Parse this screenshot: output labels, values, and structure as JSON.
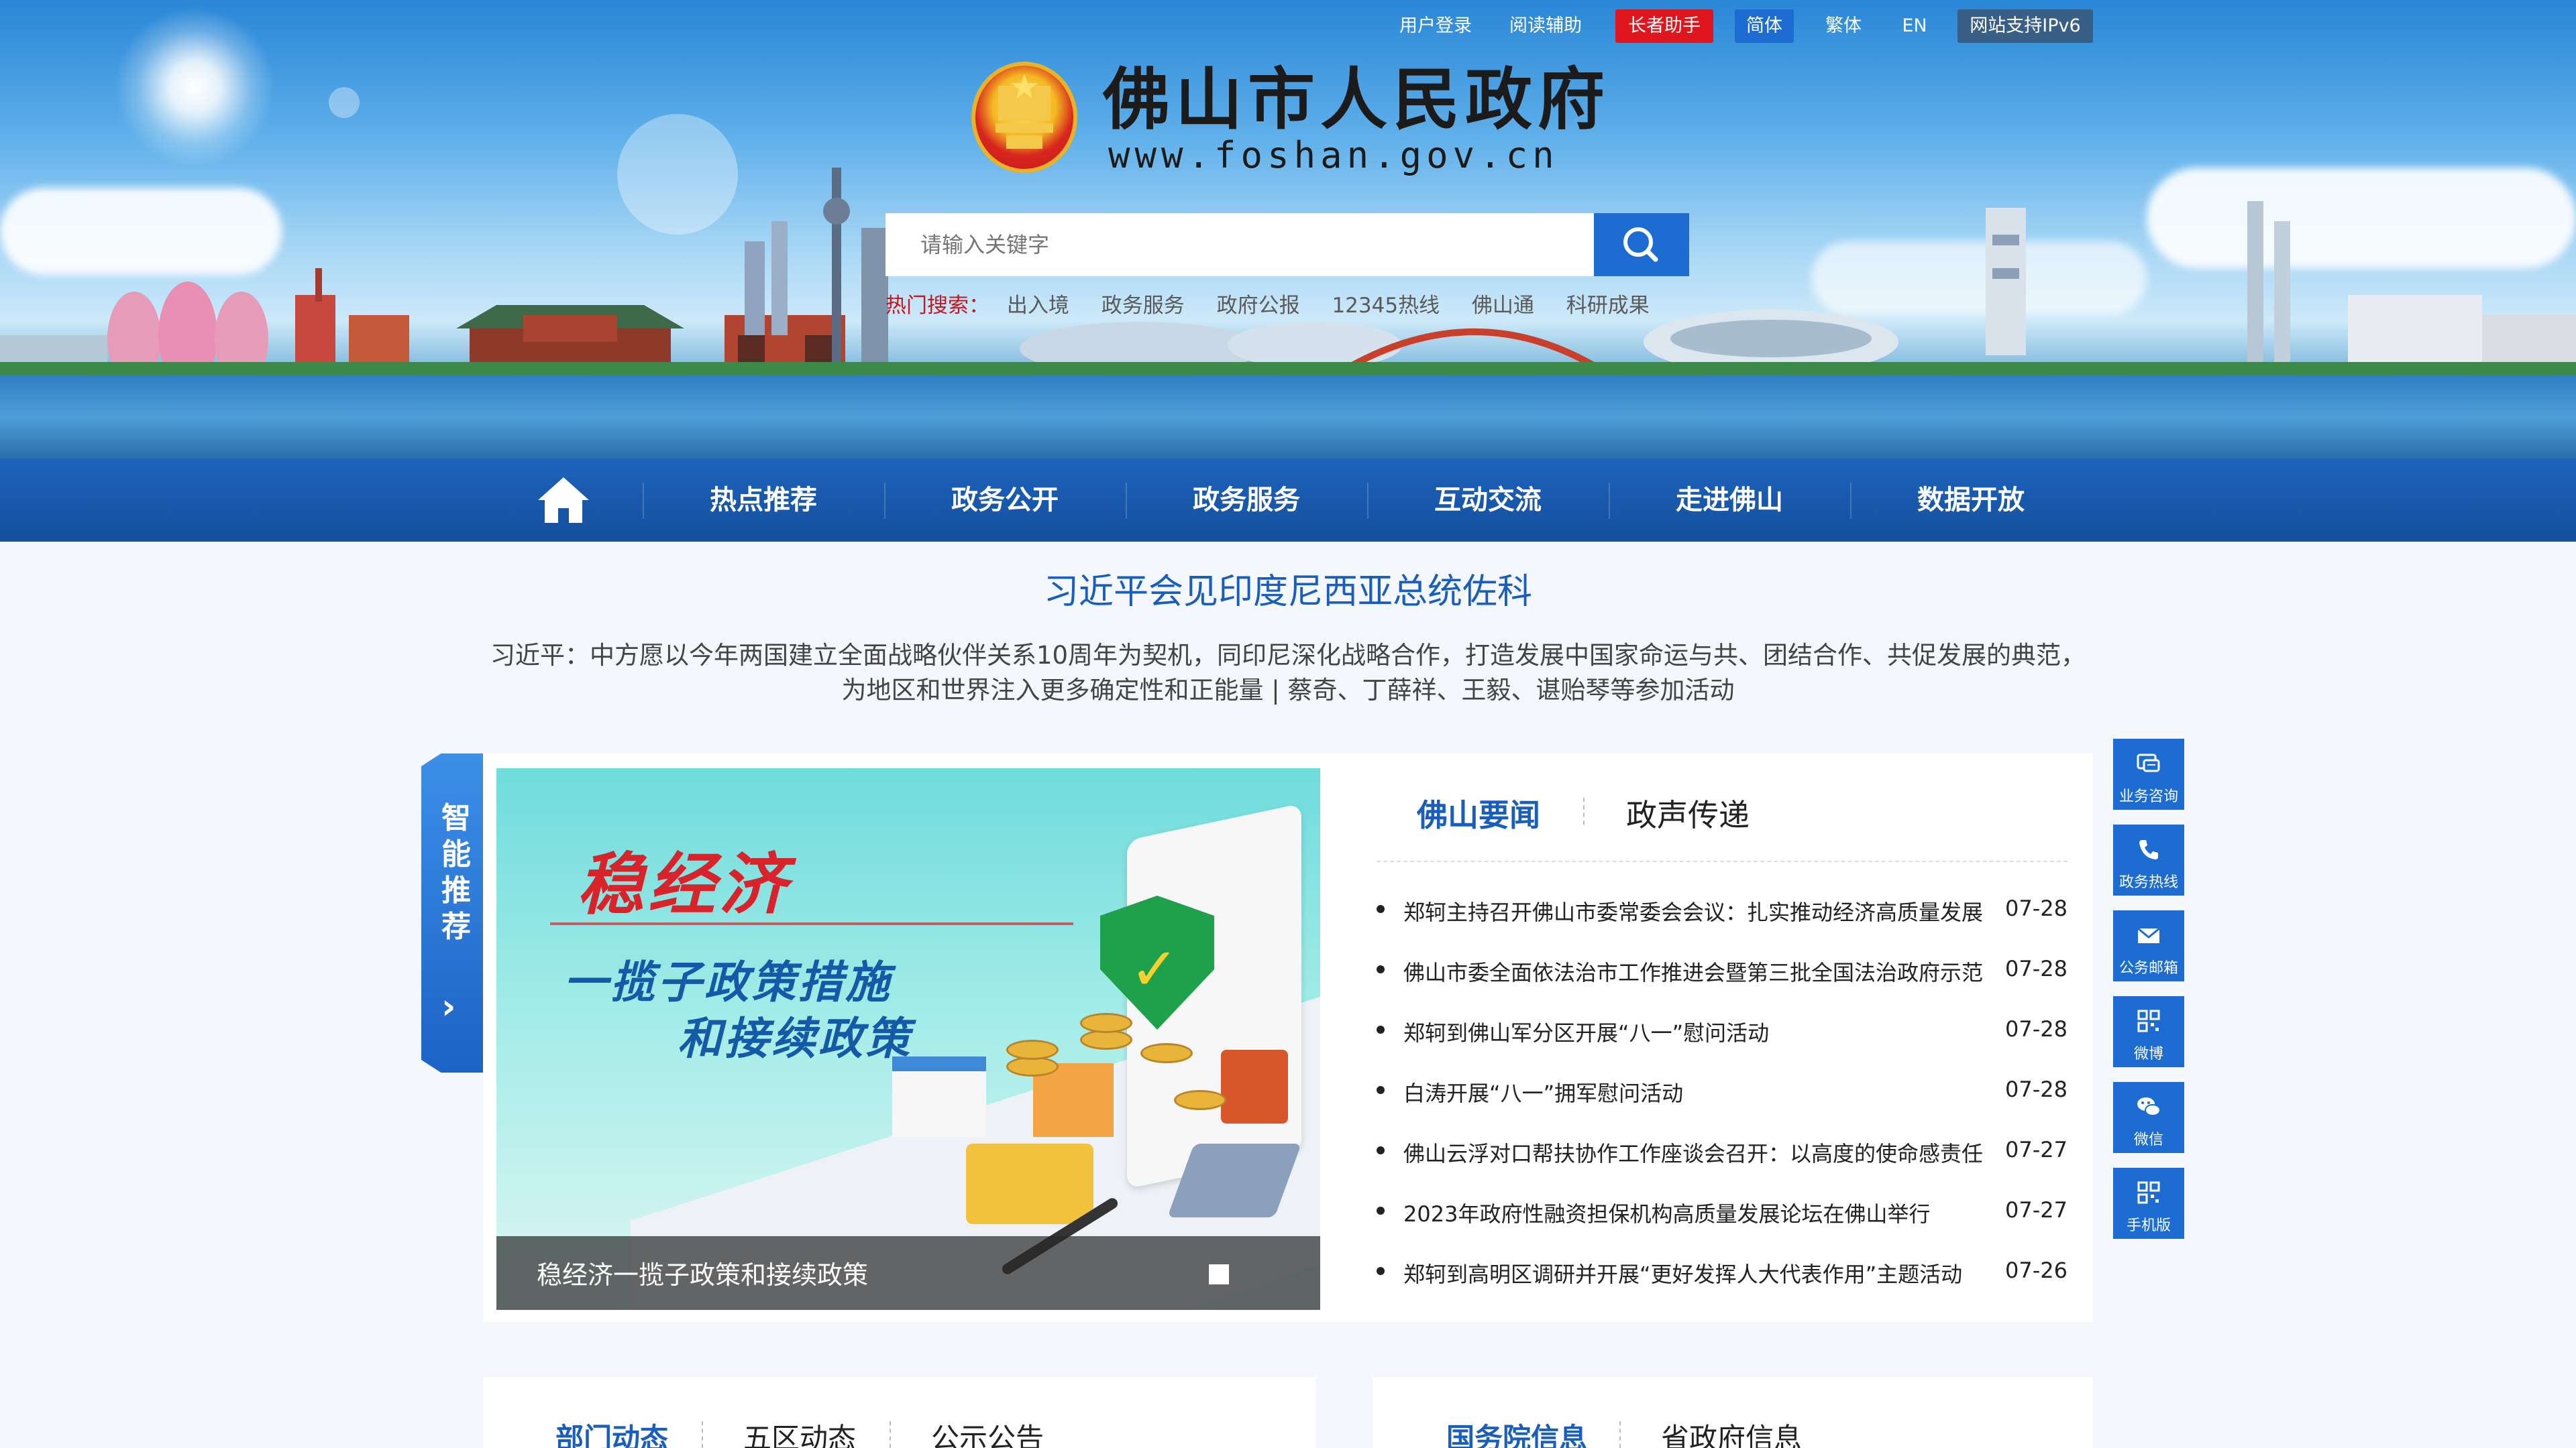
{
  "utility_bar": {
    "login": "用户登录",
    "reading_aid": "阅读辅助",
    "elder_assistant": "长者助手",
    "simplified": "简体",
    "traditional": "繁体",
    "english": "EN",
    "ipv6": "网站支持IPv6"
  },
  "header": {
    "title": "佛山市人民政府",
    "url": "www.foshan.gov.cn"
  },
  "search": {
    "placeholder": "请输入关键字",
    "hot_label": "热门搜索：",
    "hot_items": [
      "出入境",
      "政务服务",
      "政府公报",
      "12345热线",
      "佛山通",
      "科研成果"
    ]
  },
  "nav": {
    "items": [
      "热点推荐",
      "政务公开",
      "政务服务",
      "互动交流",
      "走进佛山",
      "数据开放"
    ]
  },
  "headline": {
    "title": "习近平会见印度尼西亚总统佐科",
    "summary": "习近平：中方愿以今年两国建立全面战略伙伴关系10周年为契机，同印尼深化战略合作，打造发展中国家命运与共、团结合作、共促发展的典范，为地区和世界注入更多确定性和正能量 | 蔡奇、丁薛祥、王毅、谌贻琴等参加活动"
  },
  "smart_recommend": {
    "label": "智能推荐",
    "arrow": "›"
  },
  "slideshow": {
    "image_title": "稳经济",
    "image_line1": "一揽子政策措施",
    "image_line2": "和接续政策",
    "caption": "稳经济一揽子政策和接续政策"
  },
  "news": {
    "tabs": [
      "佛山要闻",
      "政声传递"
    ],
    "items": [
      {
        "title": "郑轲主持召开佛山市委常委会会议：扎实推动经济高质量发展",
        "date": "07-28"
      },
      {
        "title": "佛山市委全面依法治市工作推进会暨第三批全国法治政府示范",
        "date": "07-28"
      },
      {
        "title": "郑轲到佛山军分区开展“八一”慰问活动",
        "date": "07-28"
      },
      {
        "title": "白涛开展“八一”拥军慰问活动",
        "date": "07-28"
      },
      {
        "title": "佛山云浮对口帮扶协作工作座谈会召开：以高度的使命感责任",
        "date": "07-27"
      },
      {
        "title": "2023年政府性融资担保机构高质量发展论坛在佛山举行",
        "date": "07-27"
      },
      {
        "title": "郑轲到高明区调研并开展“更好发挥人大代表作用”主题活动",
        "date": "07-26"
      }
    ]
  },
  "float_menu": [
    {
      "label": "业务咨询",
      "icon": "consult-icon"
    },
    {
      "label": "政务热线",
      "icon": "phone-icon"
    },
    {
      "label": "公务邮箱",
      "icon": "mail-icon"
    },
    {
      "label": "微博",
      "icon": "qrcode-icon"
    },
    {
      "label": "微信",
      "icon": "wechat-icon"
    },
    {
      "label": "手机版",
      "icon": "qrcode-icon"
    }
  ],
  "bottom_left": {
    "tabs": [
      "部门动态",
      "五区动态",
      "公示公告"
    ]
  },
  "bottom_right": {
    "tabs": [
      "国务院信息",
      "省政府信息"
    ]
  },
  "colors": {
    "brand_blue": "#1c6cd2",
    "nav_blue": "#1e63bd",
    "headline_blue": "#1a5ebd",
    "elder_red": "#e0161e",
    "hot_red": "#c8151d"
  }
}
